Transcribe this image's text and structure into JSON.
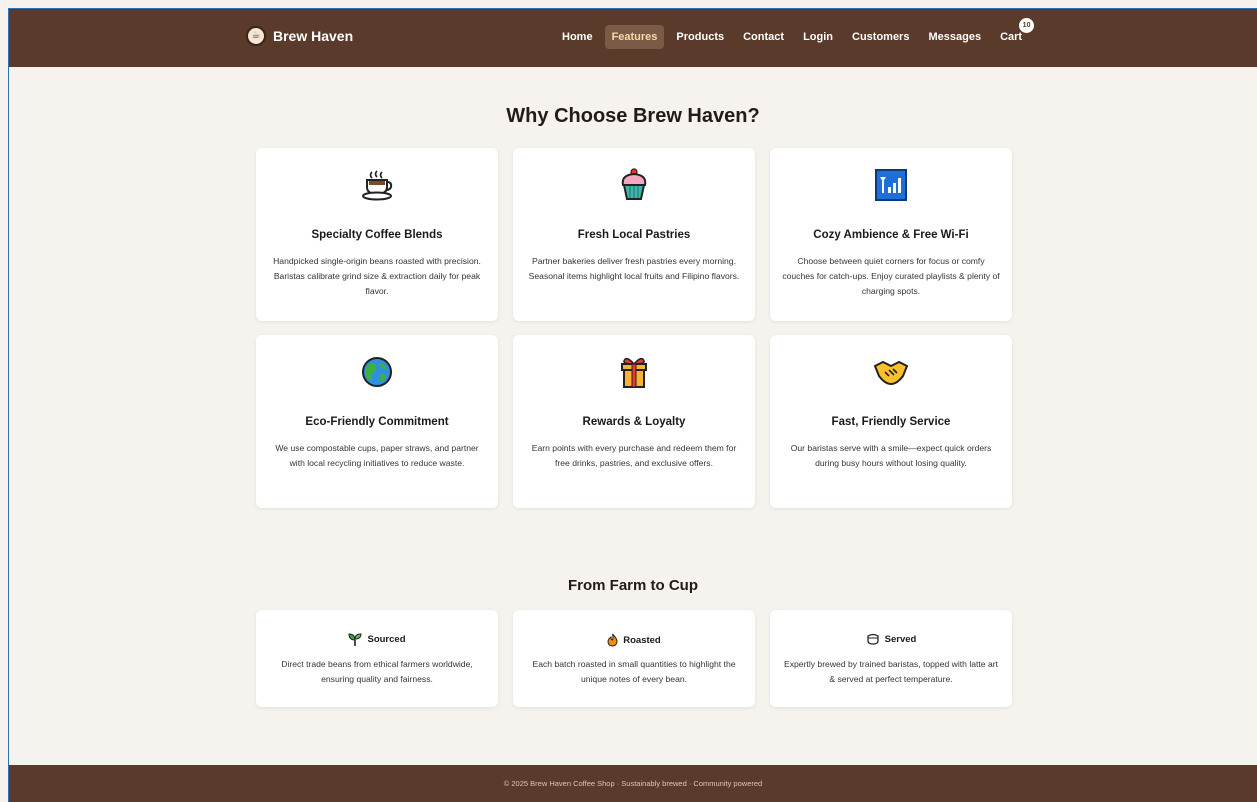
{
  "nav": {
    "brand": "Brew Haven",
    "links": [
      "Home",
      "Features",
      "Products",
      "Contact",
      "Login",
      "Customers",
      "Messages",
      "Cart"
    ],
    "active": "Features",
    "cart_count": "10"
  },
  "features": {
    "heading": "Why Choose Brew Haven?",
    "cards": [
      {
        "icon": "coffee-cup-icon",
        "title": "Specialty Coffee Blends",
        "desc": "Handpicked single-origin beans roasted with precision. Baristas calibrate grind size & extraction daily for peak flavor."
      },
      {
        "icon": "cupcake-icon",
        "title": "Fresh Local Pastries",
        "desc": "Partner bakeries deliver fresh pastries every morning. Seasonal items highlight local fruits and Filipino flavors."
      },
      {
        "icon": "wifi-signal-icon",
        "title": "Cozy Ambience & Free Wi-Fi",
        "desc": "Choose between quiet corners for focus or comfy couches for catch-ups. Enjoy curated playlists & plenty of charging spots."
      },
      {
        "icon": "globe-icon",
        "title": "Eco-Friendly Commitment",
        "desc": "We use compostable cups, paper straws, and partner with local recycling initiatives to reduce waste."
      },
      {
        "icon": "gift-icon",
        "title": "Rewards & Loyalty",
        "desc": "Earn points with every purchase and redeem them for free drinks, pastries, and exclusive offers."
      },
      {
        "icon": "handshake-icon",
        "title": "Fast, Friendly Service",
        "desc": "Our baristas serve with a smile—expect quick orders during busy hours without losing quality."
      }
    ]
  },
  "farm": {
    "heading": "From Farm to Cup",
    "cards": [
      {
        "icon": "sprout-icon",
        "title": "Sourced",
        "desc": "Direct trade beans from ethical farmers worldwide, ensuring quality and fairness."
      },
      {
        "icon": "flame-icon",
        "title": "Roasted",
        "desc": "Each batch roasted in small quantities to highlight the unique notes of every bean."
      },
      {
        "icon": "cup-icon",
        "title": "Served",
        "desc": "Expertly brewed by trained baristas, topped with latte art & served at perfect temperature."
      }
    ]
  },
  "footer": {
    "text": "© 2025 Brew Haven Coffee Shop · Sustainably brewed · Community powered"
  },
  "colors": {
    "nav_bg": "#5a3a2a",
    "active_link_bg": "#7b5a46",
    "active_link_text": "#f1dcaa",
    "page_bg": "#f6f3ee"
  }
}
